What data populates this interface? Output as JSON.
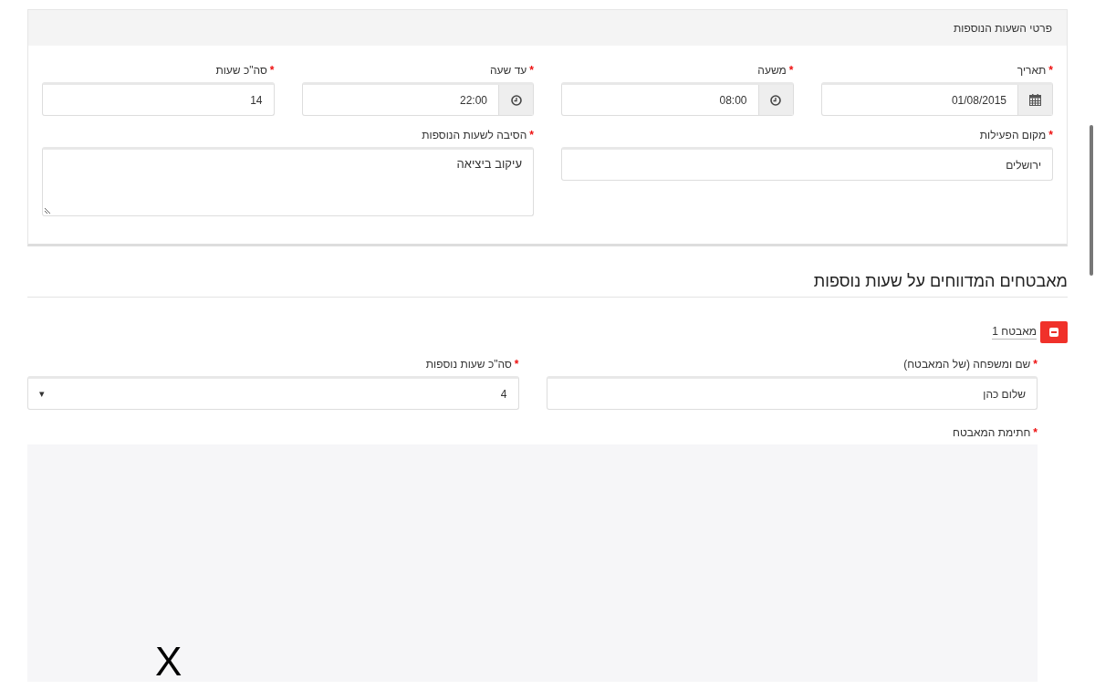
{
  "panel": {
    "title": "פרטי השעות הנוספות",
    "fields": [
      {
        "kind": "date",
        "label": "תאריך",
        "required_mark": "*",
        "value": "01/08/2015"
      },
      {
        "kind": "time",
        "label": "משעה",
        "required_mark": "*",
        "value": "08:00"
      },
      {
        "kind": "time",
        "label": "עד שעה",
        "required_mark": "*",
        "value": "22:00"
      },
      {
        "kind": "text",
        "label": "סה\"כ שעות",
        "required_mark": "*",
        "value": "14"
      },
      {
        "kind": "wide",
        "label": "מקום הפעילות",
        "required_mark": "*",
        "value": "ירושלים"
      },
      {
        "kind": "textarea",
        "label": "הסיבה לשעות הנוספות",
        "required_mark": "*",
        "value": "עיקוב ביציאה"
      }
    ]
  },
  "guards_section": {
    "title": "מאבטחים המדווחים על שעות נוספות",
    "guards": [
      {
        "name": "מאבטח 1",
        "fields": [
          {
            "kind": "text",
            "label": "שם ומשפחה (של המאבטח)",
            "required_mark": "*",
            "value": "שלום כהן"
          },
          {
            "kind": "select",
            "label": "סה\"כ שעות נוספות",
            "required_mark": "*",
            "value": "4",
            "caret": "▾"
          }
        ],
        "signature": {
          "label": "חתימת המאבטח",
          "required_mark": "*",
          "mark": "X"
        }
      }
    ]
  }
}
